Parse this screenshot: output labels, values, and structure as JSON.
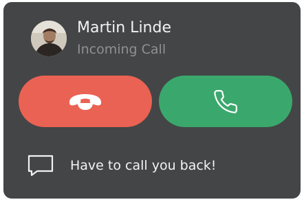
{
  "caller": {
    "name": "Martin Linde",
    "status": "Incoming Call",
    "avatar_icon": "person-avatar"
  },
  "actions": {
    "decline": {
      "icon": "phone-hangup-icon",
      "color": "#ea6253"
    },
    "accept": {
      "icon": "phone-icon",
      "color": "#3aa86c"
    }
  },
  "quick_reply": {
    "icon": "chat-bubble-icon",
    "text": "Have to call you back!"
  },
  "colors": {
    "card_background": "#444546",
    "primary_text": "#f3f3f3",
    "secondary_text": "#8e9092"
  }
}
